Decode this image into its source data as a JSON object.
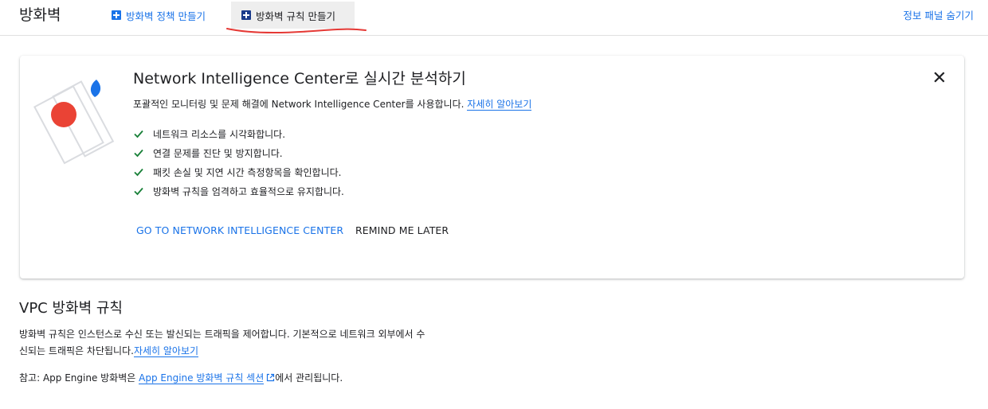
{
  "header": {
    "title": "방화벽",
    "tabs": [
      {
        "label": "방화벽 정책 만들기",
        "icon": "add-box-icon"
      },
      {
        "label": "방화벽 규칙 만들기",
        "icon": "add-box-icon"
      }
    ],
    "hide_panel_label": "정보 패널 숨기기"
  },
  "banner": {
    "title": "Network Intelligence Center로 실시간 분석하기",
    "desc_text": "포괄적인 모니터링 및 문제 해결에 Network Intelligence Center를 사용합니다.",
    "desc_link": "자세히 알아보기",
    "checklist": [
      "네트워크 리소스를 시각화합니다.",
      "연결 문제를 진단 및 방지합니다.",
      "패킷 손실 및 지연 시간 측정항목을 확인합니다.",
      "방화벽 규칙을 엄격하고 효율적으로 유지합니다."
    ],
    "primary_button": "GO TO NETWORK INTELLIGENCE CENTER",
    "secondary_button": "REMIND ME LATER"
  },
  "section": {
    "title": "VPC 방화벽 규칙",
    "desc_text": "방화벽 규칙은 인스턴스로 수신 또는 발신되는 트래픽을 제어합니다. 기본적으로 네트워크 외부에서 수신되는 트래픽은 차단됩니다.",
    "desc_link": "자세히 알아보기",
    "note_prefix": "참고: App Engine 방화벽은",
    "note_link": "App Engine 방화벽 규칙 섹션",
    "note_suffix": "에서 관리됩니다."
  },
  "colors": {
    "accent": "#1a73e8",
    "check": "#188038",
    "annotation": "#e53935"
  }
}
